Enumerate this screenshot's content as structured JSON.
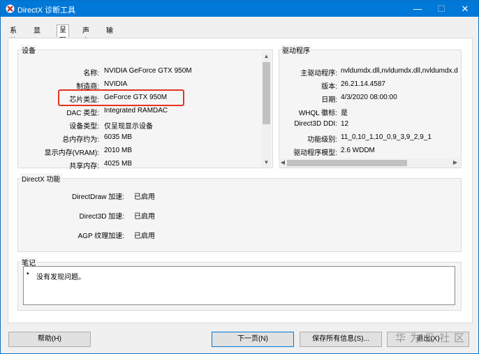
{
  "window": {
    "title": "DirectX 诊断工具",
    "min": "—",
    "max": "☐",
    "close": "✕"
  },
  "tabs": [
    "系统",
    "显示",
    "呈现",
    "声音",
    "输入"
  ],
  "device": {
    "group_label": "设备",
    "rows": [
      {
        "label": "名称:",
        "value": "NVIDIA GeForce GTX 950M"
      },
      {
        "label": "制造商:",
        "value": "NVIDIA"
      },
      {
        "label": "芯片类型:",
        "value": "GeForce GTX 950M"
      },
      {
        "label": "DAC 类型:",
        "value": "Integrated RAMDAC"
      },
      {
        "label": "设备类型:",
        "value": "仅呈现显示设备"
      },
      {
        "label": "总内存约为:",
        "value": "6035 MB"
      },
      {
        "label": "显示内存(VRAM):",
        "value": "2010 MB"
      },
      {
        "label": "共享内存:",
        "value": "4025 MB"
      }
    ]
  },
  "driver": {
    "group_label": "驱动程序",
    "rows": [
      {
        "label": "主驱动程序:",
        "value": "nvldumdx.dll,nvldumdx.dll,nvldumdx.d"
      },
      {
        "label": "版本:",
        "value": "26.21.14.4587"
      },
      {
        "label": "日期:",
        "value": "4/3/2020 08:00:00"
      },
      {
        "label": "WHQL 徽标:",
        "value": "是"
      },
      {
        "label": "Direct3D DDI:",
        "value": "12"
      },
      {
        "label": "功能级别:",
        "value": "11_0,10_1,10_0,9_3,9_2,9_1"
      },
      {
        "label": "驱动程序模型:",
        "value": "2.6 WDDM"
      }
    ]
  },
  "directx": {
    "group_label": "DirectX 功能",
    "rows": [
      {
        "label": "DirectDraw 加速:",
        "value": "已启用"
      },
      {
        "label": "Direct3D 加速:",
        "value": "已启用"
      },
      {
        "label": "AGP 纹理加速:",
        "value": "已启用"
      }
    ]
  },
  "notes": {
    "group_label": "笔记",
    "items": [
      "没有发现问题。"
    ]
  },
  "buttons": {
    "help": "帮助(H)",
    "next": "下一页(N)",
    "save": "保存所有信息(S)...",
    "exit": "退出(X)"
  },
  "watermark": "华为云社区",
  "colors": {
    "title_bar": "#0078d7",
    "highlight": "#e53323"
  }
}
